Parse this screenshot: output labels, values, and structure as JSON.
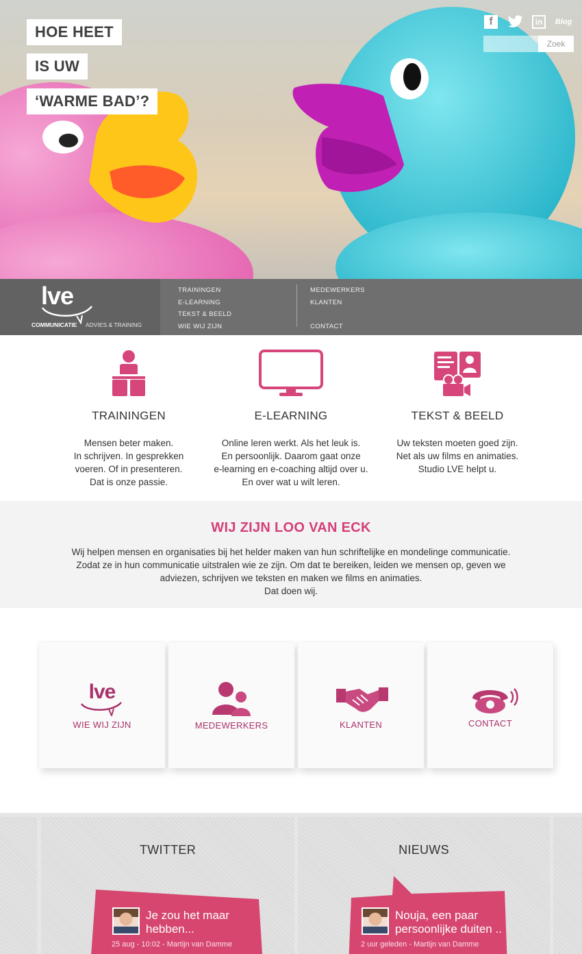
{
  "hero": {
    "headline": [
      "HOE HEET",
      "IS UW",
      "‘WARME BAD’?"
    ],
    "social": [
      {
        "icon": "facebook-icon",
        "label": "f"
      },
      {
        "icon": "twitter-icon",
        "label": "🐦"
      },
      {
        "icon": "linkedin-icon",
        "label": "in"
      },
      {
        "icon": "blog-icon",
        "label": "Blog"
      }
    ],
    "search": {
      "placeholder": "",
      "button": "Zoek"
    }
  },
  "nav": {
    "logo": {
      "mark": "lve",
      "word1": "COMMUNICATIE",
      "word2": "ADVIES & TRAINING"
    },
    "col1": [
      "TRAININGEN",
      "E-LEARNING",
      "TEKST & BEELD",
      "WIE WIJ ZIJN"
    ],
    "col2": [
      "MEDEWERKERS",
      "KLANTEN",
      "CONTACT"
    ]
  },
  "services": [
    {
      "icon": "trainingen-icon",
      "title": "TRAININGEN",
      "text": [
        "Mensen beter maken.",
        "In schrijven. In gesprekken",
        "voeren. Of in presenteren.",
        "Dat is onze passie."
      ]
    },
    {
      "icon": "e-learning-monitor-icon",
      "title": "E-LEARNING",
      "text": [
        "Online leren werkt. Als het leuk is.",
        "En persoonlijk. Daarom gaat onze",
        "e-learning en e-coaching altijd over u.",
        "En over wat u wilt leren."
      ]
    },
    {
      "icon": "tekst-beeld-icon",
      "title": "TEKST & BEELD",
      "text": [
        "Uw teksten moeten goed zijn.",
        "Net als uw films en animaties.",
        "Studio LVE helpt u."
      ]
    }
  ],
  "about": {
    "title": "WIJ ZIJN LOO VAN ECK",
    "text": [
      "Wij helpen mensen en organisaties bij het helder maken van hun schriftelijke en mondelinge communicatie.",
      "Zodat ze in hun communicatie uitstralen wie ze zijn. Om dat te bereiken, leiden we mensen op, geven we",
      "adviezen, schrijven we teksten en maken we films en animaties.",
      "Dat doen wij."
    ]
  },
  "tiles": [
    {
      "icon": "lve-logo-icon",
      "label": "WIE WIJ ZIJN",
      "mark": "lve"
    },
    {
      "icon": "people-icon",
      "label": "MEDEWERKERS"
    },
    {
      "icon": "handshake-icon",
      "label": "KLANTEN"
    },
    {
      "icon": "phone-icon",
      "label": "CONTACT"
    }
  ],
  "feeds": {
    "twitter": {
      "title": "TWITTER",
      "text": [
        "Je zou het maar",
        "hebben..."
      ],
      "meta": "25 aug - 10:02 - Martijn van Damme"
    },
    "nieuws": {
      "title": "NIEUWS",
      "text": [
        "Nouja, een paar",
        "persoonlijke duiten .."
      ],
      "meta": "2 uur geleden - Martijn van Damme"
    }
  },
  "colors": {
    "accent": "#d6467b",
    "nav": "#6f6f6f",
    "about_bg": "#f3f3f3"
  }
}
